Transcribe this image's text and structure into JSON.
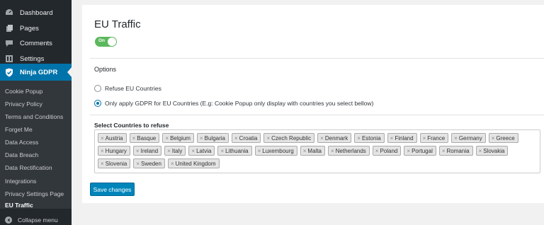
{
  "sidebar": {
    "items": [
      {
        "label": "Dashboard",
        "icon": "dashboard-icon"
      },
      {
        "label": "Pages",
        "icon": "pages-icon"
      },
      {
        "label": "Comments",
        "icon": "comments-icon"
      },
      {
        "label": "Settings",
        "icon": "settings-icon"
      },
      {
        "label": "Ninja GDPR",
        "icon": "shield-icon"
      }
    ],
    "submenu": [
      "Cookie Popup",
      "Privacy Policy",
      "Terms and Conditions",
      "Forget Me",
      "Data Access",
      "Data Breach",
      "Data Rectification",
      "Integrations",
      "Privacy Settings Page",
      "EU Traffic"
    ],
    "collapse_label": "Collapse menu",
    "active_color": "#0073aa"
  },
  "main": {
    "title": "EU Traffic",
    "toggle": {
      "label": "On",
      "checked": true,
      "color": "#5cb85c"
    },
    "options_label": "Options",
    "radios": [
      {
        "label": "Refuse EU Countries",
        "checked": false
      },
      {
        "label": "Only apply GDPR for EU Countries (E.g: Cookie Popup only display with countries you select bellow)",
        "checked": true
      }
    ],
    "select_label": "Select Countries to refuse",
    "countries": [
      "Austria",
      "Basque",
      "Belgium",
      "Bulgaria",
      "Croatia",
      "Czech Republic",
      "Denmark",
      "Estonia",
      "Finland",
      "France",
      "Germany",
      "Greece",
      "Hungary",
      "Ireland",
      "Italy",
      "Latvia",
      "Lithuania",
      "Luxembourg",
      "Malta",
      "Netherlands",
      "Poland",
      "Portugal",
      "Romania",
      "Slovakia",
      "Slovenia",
      "Sweden",
      "United Kingdom"
    ],
    "remove_glyph": "×",
    "save_label": "Save changes",
    "button_color": "#0085ba"
  }
}
